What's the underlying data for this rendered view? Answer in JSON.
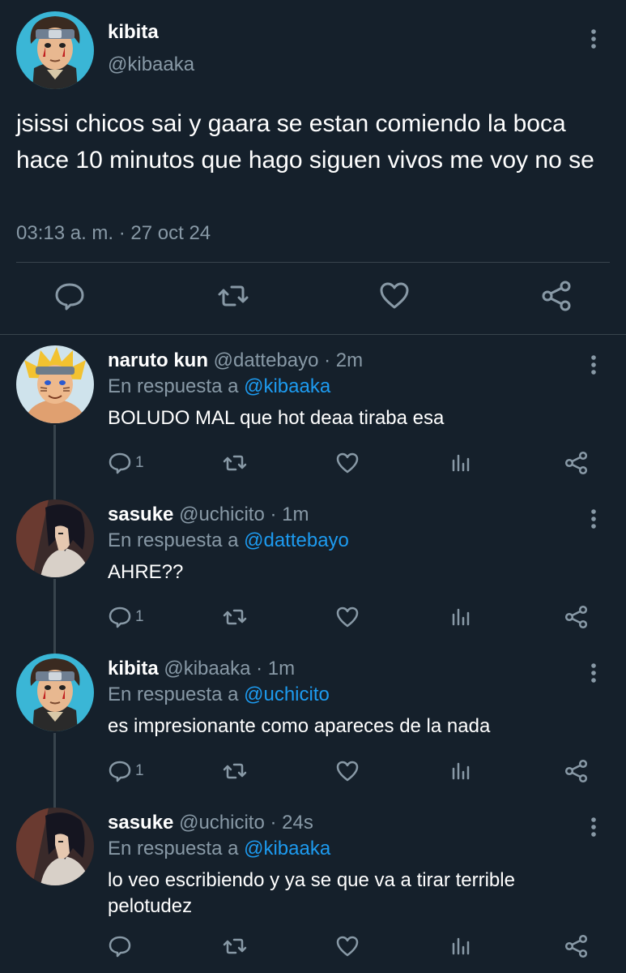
{
  "main_tweet": {
    "name": "kibita",
    "handle": "@kibaaka",
    "text": "jsissi chicos sai y gaara se estan comiendo la boca hace 10 minutos que hago siguen vivos me voy no se",
    "timestamp": "03:13 a. m. · 27 oct 24",
    "actions": [
      "reply-icon",
      "retweet-icon",
      "like-icon",
      "share-icon"
    ]
  },
  "replies": [
    {
      "name": "naruto kun",
      "handle": "@dattebayo",
      "time": "· 2m",
      "replying_prefix": "En respuesta a",
      "replying_to": "@kibaaka",
      "text": "BOLUDO MAL que hot deaa tiraba esa",
      "reply_count": "1"
    },
    {
      "name": "sasuke",
      "handle": "@uchicito",
      "time": "· 1m",
      "replying_prefix": "En respuesta a",
      "replying_to": "@dattebayo",
      "text": "AHRE??",
      "reply_count": "1"
    },
    {
      "name": "kibita",
      "handle": "@kibaaka",
      "time": "· 1m",
      "replying_prefix": "En respuesta a",
      "replying_to": "@uchicito",
      "text": "es impresionante como apareces de la nada",
      "reply_count": "1"
    },
    {
      "name": "sasuke",
      "handle": "@uchicito",
      "time": "· 24s",
      "replying_prefix": "En respuesta a",
      "replying_to": "@kibaaka",
      "text": "lo veo escribiendo y ya se que va a tirar terrible pelotudez",
      "reply_count": ""
    }
  ],
  "colors": {
    "background": "#15202b",
    "muted": "#8899a6",
    "link": "#1d9bf0",
    "border": "#38444d"
  }
}
